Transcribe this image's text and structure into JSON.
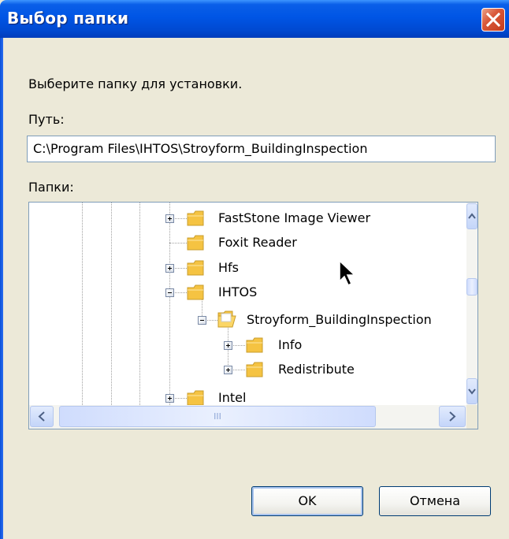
{
  "window": {
    "title": "Выбор папки"
  },
  "prompt": "Выберите папку для установки.",
  "path": {
    "label": "Путь:",
    "value": "C:\\Program Files\\IHTOS\\Stroyform_BuildingInspection"
  },
  "folders": {
    "label": "Папки:",
    "items": [
      {
        "label": "FastStone Image Viewer",
        "expander": "plus"
      },
      {
        "label": "Foxit Reader",
        "expander": "none"
      },
      {
        "label": "Hfs",
        "expander": "plus"
      },
      {
        "label": "IHTOS",
        "expander": "minus"
      },
      {
        "label": "Stroyform_BuildingInspection",
        "expander": "minus",
        "open": true
      },
      {
        "label": "Info",
        "expander": "plus"
      },
      {
        "label": "Redistribute",
        "expander": "plus"
      },
      {
        "label": "Intel",
        "expander": "plus"
      }
    ],
    "hscroll_grip": "III"
  },
  "buttons": {
    "ok": "OK",
    "cancel": "Отмена"
  },
  "colors": {
    "titlebar": "#0055e5",
    "folder": "#f5c342",
    "dialog_bg": "#ece9d8"
  }
}
